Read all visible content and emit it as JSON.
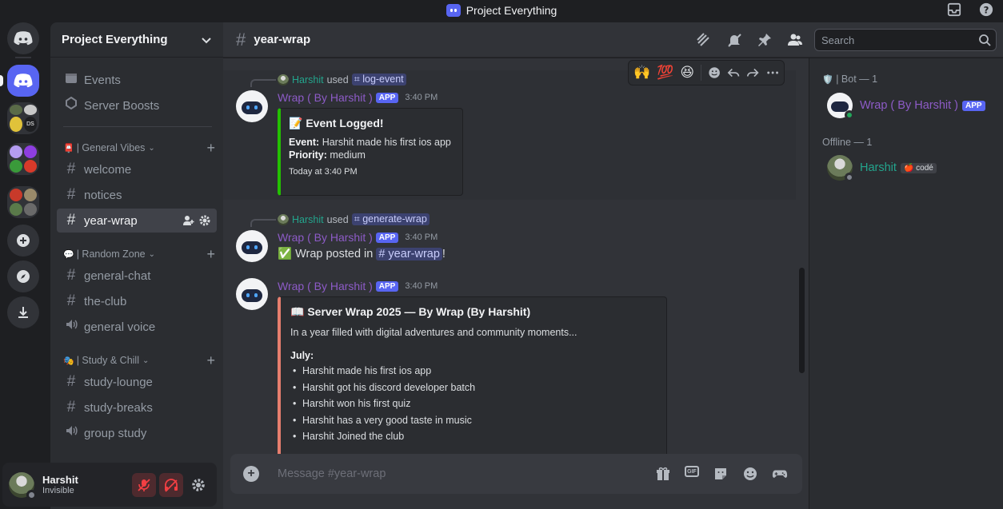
{
  "window": {
    "title": "Project Everything"
  },
  "server": {
    "name": "Project Everything"
  },
  "sidebar": {
    "top_items": [
      {
        "label": "Events"
      },
      {
        "label": "Server Boosts"
      }
    ],
    "categories": [
      {
        "label": "| General Vibes",
        "emoji": "📮"
      },
      {
        "label": "| Random Zone",
        "emoji": "💬"
      },
      {
        "label": "| Study & Chill",
        "emoji": "🎭"
      }
    ],
    "channels": [
      {
        "label": "welcome"
      },
      {
        "label": "notices"
      },
      {
        "label": "year-wrap"
      },
      {
        "label": "general-chat"
      },
      {
        "label": "the-club"
      },
      {
        "label": "general voice"
      },
      {
        "label": "study-lounge"
      },
      {
        "label": "study-breaks"
      },
      {
        "label": "group study"
      }
    ]
  },
  "user": {
    "name": "Harshit",
    "status": "Invisible"
  },
  "channel": {
    "name": "year-wrap"
  },
  "search": {
    "placeholder": "Search"
  },
  "toolbar": {
    "emojis": [
      "🙌",
      "💯",
      "😆"
    ]
  },
  "messages": [
    {
      "reply_user": "Harshit",
      "reply_used": "used",
      "reply_command": "log-event",
      "author": "Wrap ( By Harshit )",
      "tag": "APP",
      "time": "3:40 PM",
      "embed": {
        "title": "📝 Event Logged!",
        "event_label": "Event:",
        "event_value": "Harshit made his first ios app",
        "priority_label": "Priority:",
        "priority_value": "medium",
        "footer": "Today at 3:40 PM"
      }
    },
    {
      "reply_user": "Harshit",
      "reply_used": "used",
      "reply_command": "generate-wrap",
      "author": "Wrap ( By Harshit )",
      "tag": "APP",
      "time": "3:40 PM",
      "text_prefix": "✅ Wrap posted in",
      "channel_mention": "# year-wrap",
      "text_suffix": "!"
    },
    {
      "author": "Wrap ( By Harshit )",
      "tag": "APP",
      "time": "3:40 PM",
      "embed": {
        "title": "📖 Server Wrap 2025 — By Wrap (By Harshit)",
        "description": "In a year filled with digital adventures and community moments...",
        "month": "July:",
        "items": [
          "Harshit made his first ios app",
          "Harshit got his discord developer batch",
          "Harshit won his first quiz",
          "Harshit has a very good taste in music",
          "Harshit Joined the club"
        ]
      }
    }
  ],
  "input": {
    "placeholder": "Message #year-wrap"
  },
  "members": {
    "bot_category": "| Bot — 1",
    "bot_emoji": "🛡️",
    "bot_name": "Wrap ( By Harshit )",
    "bot_tag": "APP",
    "offline_category": "Offline — 1",
    "offline_name": "Harshit",
    "offline_tag": "🍎 codé"
  },
  "colors": {
    "accent": "#5865f2",
    "bot_name": "#8d5bc7",
    "user_name": "#23a58d",
    "embed1_bar": "#23c000",
    "embed2_bar": "#e67e6e"
  }
}
